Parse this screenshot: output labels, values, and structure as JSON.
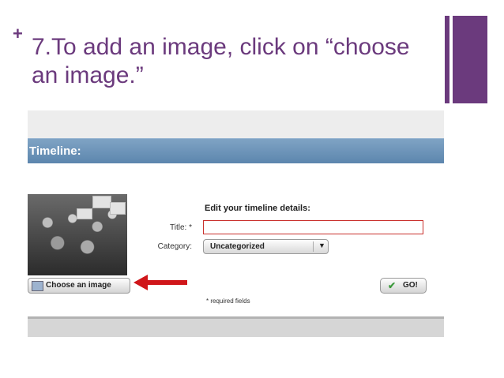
{
  "slide": {
    "bullet": "+",
    "title": "7.To add an image, click on “choose an image.”"
  },
  "screenshot": {
    "header": "Timeline:",
    "edit_heading": "Edit your timeline details:",
    "title_label": "Title: *",
    "title_value": "",
    "category_label": "Category:",
    "category_value": "Uncategorized",
    "choose_image_label": "Choose an image",
    "go_label": "GO!",
    "required_note": "* required fields"
  },
  "colors": {
    "accent": "#6b3a7d",
    "header_bar": "#6a91b8",
    "arrow": "#d0161a",
    "error_border": "#c9302c"
  },
  "icons": {
    "choose_image": "image-icon",
    "go": "check-icon",
    "select": "dropdown-arrow-icon",
    "pointer": "red-arrow-icon"
  }
}
